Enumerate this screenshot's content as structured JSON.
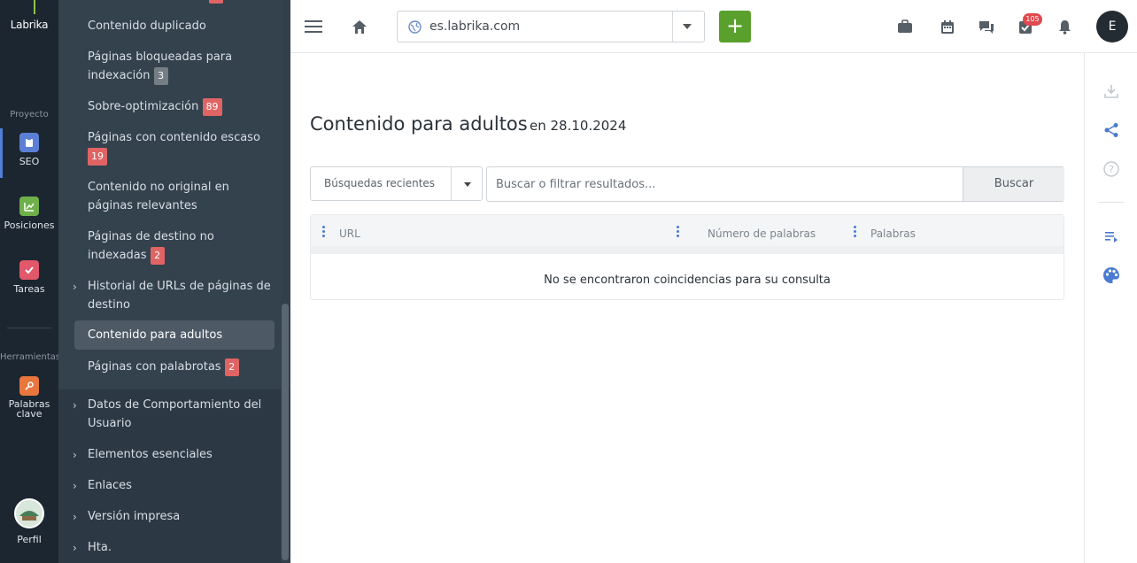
{
  "rail": {
    "logo": "Labrika",
    "project_label": "Proyecto",
    "tools_label": "Herramientas",
    "items": [
      {
        "label": "SEO",
        "icon": "seo-icon"
      },
      {
        "label": "Posiciones",
        "icon": "positions-icon"
      },
      {
        "label": "Tareas",
        "icon": "tasks-icon"
      },
      {
        "label": "Palabras clave",
        "icon": "keywords-icon"
      },
      {
        "label": "Perfil",
        "icon": "profile-avatar"
      }
    ]
  },
  "sidebar": {
    "items": [
      {
        "label": "Contenido duplicado"
      },
      {
        "label": "Páginas bloqueadas para indexación",
        "badge": "3"
      },
      {
        "label": "Sobre-optimización",
        "badge": "89"
      },
      {
        "label": "Páginas con contenido escaso",
        "badge": "19"
      },
      {
        "label": "Contenido no original en páginas relevantes"
      },
      {
        "label": "Páginas de destino no indexadas",
        "badge": "2"
      },
      {
        "label": "Historial de URLs de páginas de destino"
      },
      {
        "label": "Contenido para adultos"
      },
      {
        "label": "Páginas con palabrotas",
        "badge": "2"
      },
      {
        "label": "Datos de Comportamiento del Usuario"
      },
      {
        "label": "Elementos esenciales"
      },
      {
        "label": "Enlaces"
      },
      {
        "label": "Versión impresa"
      },
      {
        "label": "Hta."
      }
    ]
  },
  "topbar": {
    "domain": "es.labrika.com",
    "add_label": "+",
    "notification_count": "105",
    "user_initial": "E"
  },
  "main": {
    "title": "Contenido para adultos",
    "date": "en 28.10.2024",
    "recent_searches": "Búsquedas recientes",
    "search_placeholder": "Buscar o filtrar resultados...",
    "search_button": "Buscar",
    "table": {
      "columns": [
        "URL",
        "Número de palabras",
        "Palabras"
      ],
      "empty_message": "No se encontraron coincidencias para su consulta"
    }
  },
  "colors": {
    "rail_bg": "#1c2631",
    "sidebar_bg": "#2c3945",
    "accent_green": "#5aa02c",
    "badge_red": "#e06464",
    "link_blue": "#4a7bd0"
  }
}
